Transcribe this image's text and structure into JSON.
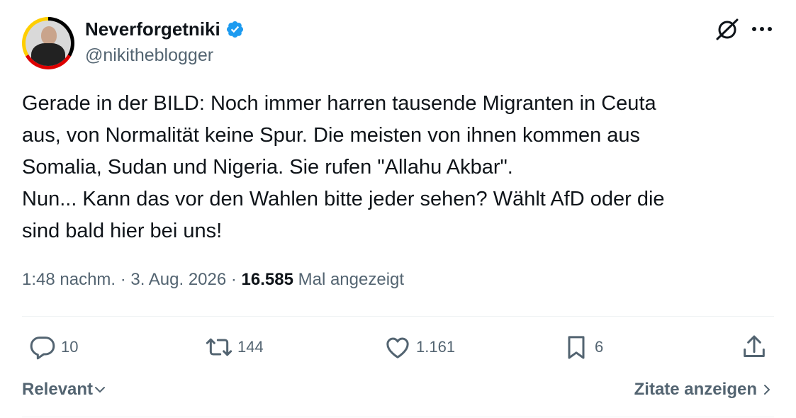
{
  "author": {
    "display_name": "Neverforgetniki",
    "handle": "@nikitheblogger",
    "verified": true
  },
  "tweet": {
    "lines": [
      "Gerade in der BILD: Noch immer harren tausende Migranten in Ceuta",
      "aus, von Normalität keine Spur. Die meisten von ihnen kommen aus",
      "Somalia, Sudan und Nigeria. Sie rufen \"Allahu Akbar\".",
      "Nun... Kann das vor den Wahlen bitte jeder sehen? Wählt AfD oder die",
      "sind bald hier bei uns!"
    ]
  },
  "meta": {
    "time": "1:48 nachm.",
    "separator": " · ",
    "date": "3. Aug. 2026",
    "views_count": "16.585",
    "views_label": " Mal angezeigt"
  },
  "actions": {
    "replies": "10",
    "reposts": "144",
    "likes": "1.161",
    "bookmarks": "6"
  },
  "footer": {
    "sort_label": "Relevant",
    "quotes_label": "Zitate anzeigen"
  },
  "colors": {
    "text": "#0f1419",
    "secondary": "#536471",
    "verified": "#1d9bf0",
    "divider": "#eff3f4"
  },
  "icons": [
    "grok-icon",
    "more-icon",
    "verified-icon",
    "reply-icon",
    "repost-icon",
    "like-icon",
    "bookmark-icon",
    "share-icon",
    "chevron-down-icon",
    "chevron-right-icon"
  ]
}
